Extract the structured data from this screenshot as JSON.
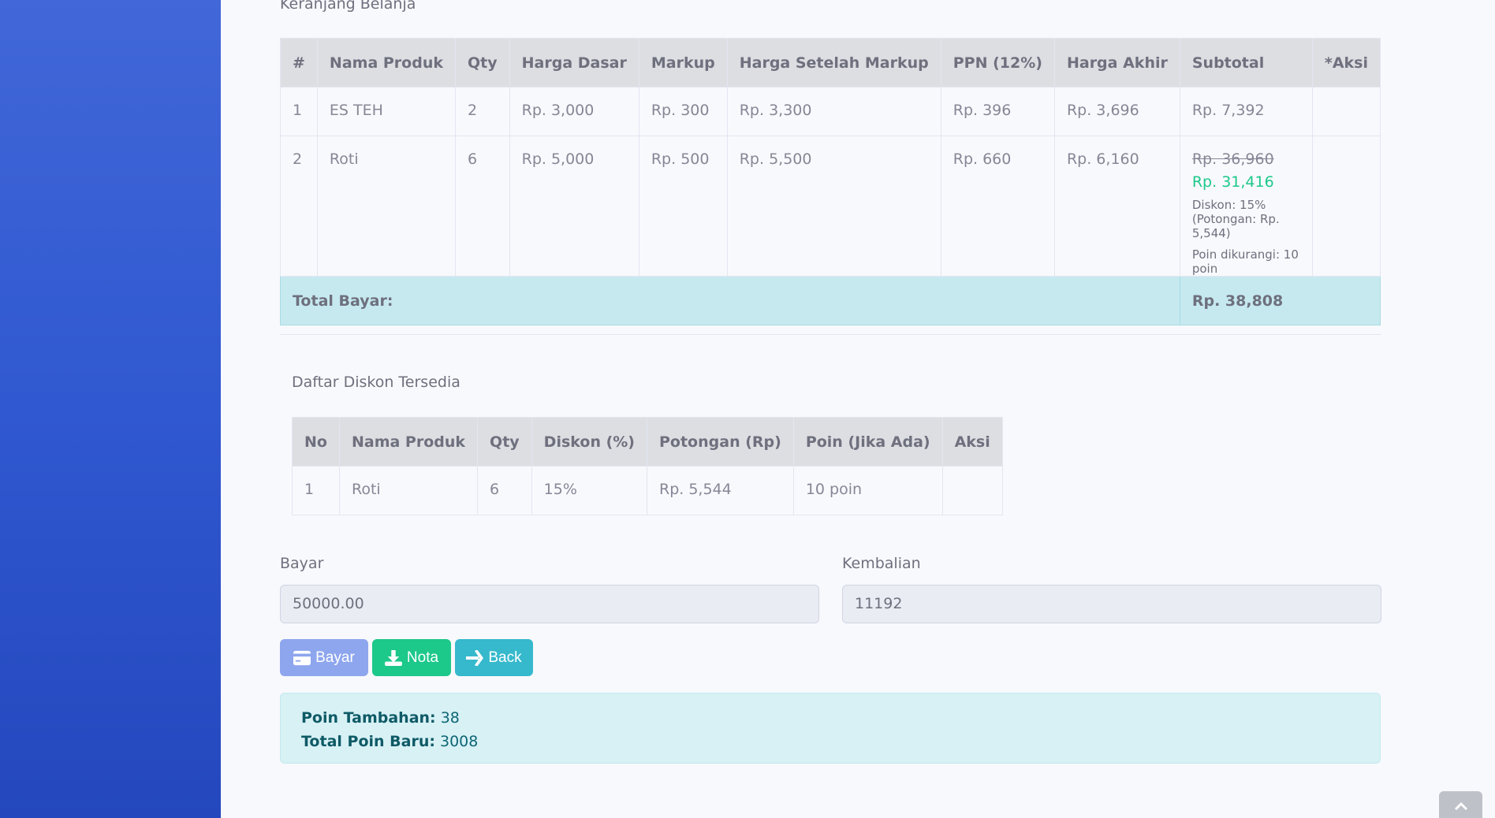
{
  "page_title": "Keranjang Belanja",
  "cart": {
    "headers": [
      "#",
      "Nama Produk",
      "Qty",
      "Harga Dasar",
      "Markup",
      "Harga Setelah Markup",
      "PPN (12%)",
      "Harga Akhir",
      "Subtotal",
      "*Aksi"
    ],
    "rows": [
      {
        "no": "1",
        "name": "ES TEH",
        "qty": "2",
        "base": "Rp. 3,000",
        "markup": "Rp. 300",
        "after_markup": "Rp. 3,300",
        "ppn": "Rp. 396",
        "final": "Rp. 3,696",
        "subtotal": "Rp. 7,392"
      },
      {
        "no": "2",
        "name": "Roti",
        "qty": "6",
        "base": "Rp. 5,000",
        "markup": "Rp. 500",
        "after_markup": "Rp. 5,500",
        "ppn": "Rp. 660",
        "final": "Rp. 6,160",
        "subtotal_old": "Rp. 36,960",
        "subtotal_new": "Rp. 31,416",
        "discount_note": "Diskon: 15% (Potongan: Rp. 5,544)",
        "points_note": "Poin dikurangi: 10 poin"
      }
    ],
    "total_label": "Total Bayar:",
    "total_value": "Rp. 38,808"
  },
  "discounts": {
    "title": "Daftar Diskon Tersedia",
    "headers": [
      "No",
      "Nama Produk",
      "Qty",
      "Diskon (%)",
      "Potongan (Rp)",
      "Poin (Jika Ada)",
      "Aksi"
    ],
    "rows": [
      {
        "no": "1",
        "name": "Roti",
        "qty": "6",
        "discount": "15%",
        "cut": "Rp. 5,544",
        "points": "10 poin"
      }
    ]
  },
  "payment": {
    "bayar_label": "Bayar",
    "bayar_value": "50000.00",
    "kembalian_label": "Kembalian",
    "kembalian_value": "11192"
  },
  "buttons": {
    "bayar": "Bayar",
    "nota": "Nota",
    "back": "Back"
  },
  "points": {
    "added_label": "Poin Tambahan:",
    "added_value": "38",
    "total_label": "Total Poin Baru:",
    "total_value": "3008"
  },
  "icons": {
    "bayar": "credit-card-icon",
    "nota": "download-icon",
    "back": "arrow-right-icon",
    "scroll": "chevron-up-icon"
  }
}
